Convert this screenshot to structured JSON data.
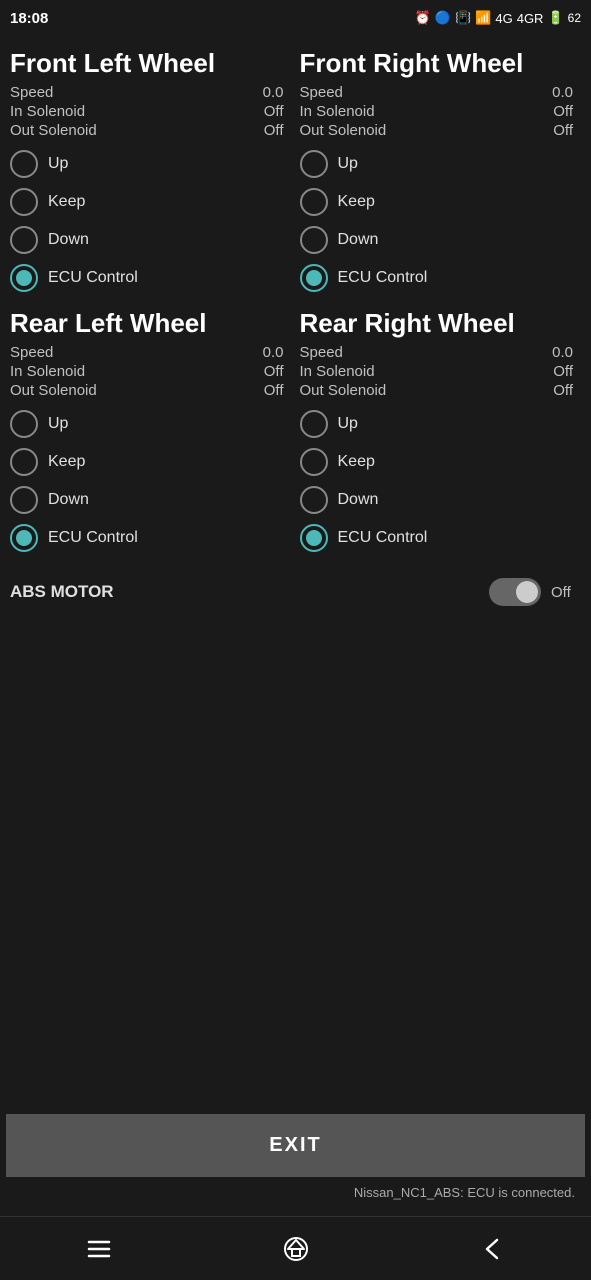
{
  "statusBar": {
    "time": "18:08",
    "batteryLevel": "62"
  },
  "wheels": {
    "frontLeft": {
      "title": "Front Left Wheel",
      "speed": "0.0",
      "inSolenoid": "Off",
      "outSolenoid": "Off",
      "options": [
        "Up",
        "Keep",
        "Down",
        "ECU Control"
      ],
      "selected": "ECU Control"
    },
    "frontRight": {
      "title": "Front Right Wheel",
      "speed": "0.0",
      "inSolenoid": "Off",
      "outSolenoid": "Off",
      "options": [
        "Up",
        "Keep",
        "Down",
        "ECU Control"
      ],
      "selected": "ECU Control"
    },
    "rearLeft": {
      "title": "Rear Left Wheel",
      "speed": "0.0",
      "inSolenoid": "Off",
      "outSolenoid": "Off",
      "options": [
        "Up",
        "Keep",
        "Down",
        "ECU Control"
      ],
      "selected": "ECU Control"
    },
    "rearRight": {
      "title": "Rear Right Wheel",
      "speed": "0.0",
      "inSolenoid": "Off",
      "outSolenoid": "Off",
      "options": [
        "Up",
        "Keep",
        "Down",
        "ECU Control"
      ],
      "selected": "ECU Control"
    }
  },
  "absMotor": {
    "label": "ABS MOTOR",
    "status": "Off",
    "enabled": false
  },
  "exitButton": {
    "label": "EXIT"
  },
  "connectionStatus": {
    "text": "Nissan_NC1_ABS: ECU is connected."
  },
  "labels": {
    "speed": "Speed",
    "inSolenoid": "In Solenoid",
    "outSolenoid": "Out Solenoid"
  }
}
